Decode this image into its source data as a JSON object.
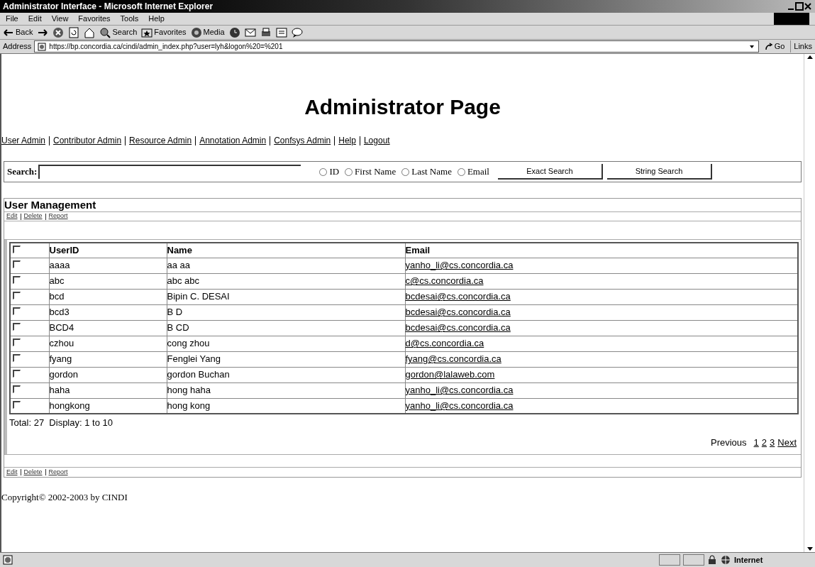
{
  "window": {
    "title": "Administrator Interface - Microsoft Internet Explorer"
  },
  "menu": [
    "File",
    "Edit",
    "View",
    "Favorites",
    "Tools",
    "Help"
  ],
  "toolbar": [
    {
      "kind": "back",
      "label": "Back"
    },
    {
      "kind": "forward"
    },
    {
      "kind": "stop"
    },
    {
      "kind": "refresh"
    },
    {
      "kind": "home"
    },
    {
      "kind": "search",
      "label": "Search"
    },
    {
      "kind": "favorites",
      "label": "Favorites"
    },
    {
      "kind": "media",
      "label": "Media"
    },
    {
      "kind": "history"
    },
    {
      "kind": "mail"
    },
    {
      "kind": "print"
    },
    {
      "kind": "edit"
    },
    {
      "kind": "discuss"
    }
  ],
  "address": {
    "label": "Address",
    "value": "https://bp.concordia.ca/cindi/admin_index.php?user=lyh&logon%20=%201",
    "go": "Go",
    "links": "Links"
  },
  "page": {
    "heading": "Administrator Page",
    "nav": [
      "User Admin",
      "Contributor Admin",
      "Resource Admin",
      "Annotation Admin",
      "Confsys Admin",
      "Help",
      "Logout"
    ],
    "search": {
      "label": "Search:",
      "options": [
        {
          "label": "ID",
          "selected": false
        },
        {
          "label": "First Name",
          "selected": false
        },
        {
          "label": "Last Name",
          "selected": false
        },
        {
          "label": "Email",
          "selected": false
        }
      ],
      "buttons": [
        "Exact Search",
        "String Search"
      ]
    },
    "section_title": "User Management",
    "actions_top": [
      "Edit",
      "Delete",
      "Report"
    ],
    "table": {
      "header_checked": false,
      "columns": [
        "UserID",
        "Name",
        "Email"
      ],
      "rows": [
        {
          "checked": false,
          "userid": "aaaa",
          "name": "aa aa",
          "email": "yanho_li@cs.concordia.ca"
        },
        {
          "checked": false,
          "userid": "abc",
          "name": "abc abc",
          "email": "c@cs.concordia.ca"
        },
        {
          "checked": false,
          "userid": "bcd",
          "name": "Bipin C. DESAI",
          "email": "bcdesai@cs.concordia.ca"
        },
        {
          "checked": false,
          "userid": "bcd3",
          "name": "B D",
          "email": "bcdesai@cs.concordia.ca"
        },
        {
          "checked": false,
          "userid": "BCD4",
          "name": "B CD",
          "email": "bcdesai@cs.concordia.ca"
        },
        {
          "checked": false,
          "userid": "czhou",
          "name": "cong zhou",
          "email": "d@cs.concordia.ca"
        },
        {
          "checked": false,
          "userid": "fyang",
          "name": "Fenglei Yang",
          "email": "fyang@cs.concordia.ca"
        },
        {
          "checked": false,
          "userid": "gordon",
          "name": "gordon Buchan",
          "email": "gordon@lalaweb.com"
        },
        {
          "checked": false,
          "userid": "haha",
          "name": "hong haha",
          "email": "yanho_li@cs.concordia.ca"
        },
        {
          "checked": false,
          "userid": "hongkong",
          "name": "hong kong",
          "email": "yanho_li@cs.concordia.ca"
        }
      ]
    },
    "summary": "Total: 27  Display: 1 to 10",
    "pager": {
      "previous": "Previous",
      "pages": [
        {
          "label": "1",
          "selected": false
        },
        {
          "label": "2",
          "selected": false
        },
        {
          "label": "3",
          "selected": false
        }
      ],
      "next": "Next"
    },
    "actions_bottom": [
      "Edit",
      "Delete",
      "Report"
    ],
    "copyright": "Copyright© 2002-2003 by CINDI"
  },
  "status_bar": {
    "zone": "Internet"
  }
}
